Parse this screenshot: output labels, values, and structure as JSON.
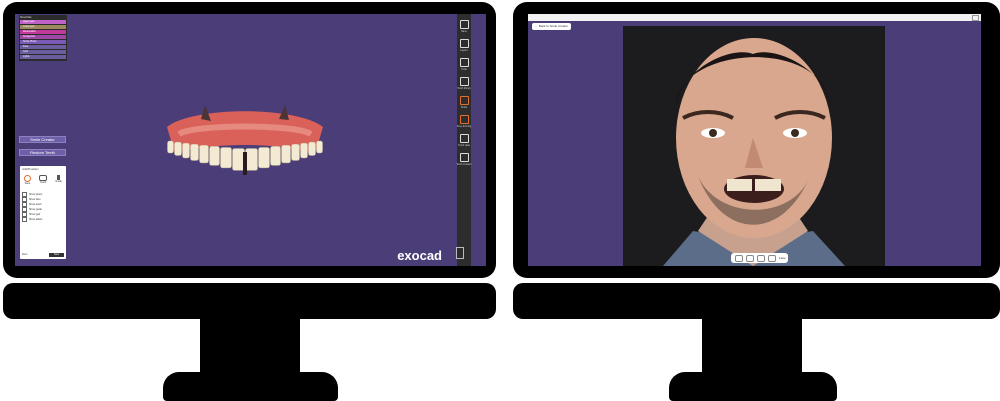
{
  "colors": {
    "screen_bg": "#4a3d78",
    "toolbar_bg": "#2d2d2d",
    "accent": "#7b5fc0",
    "gum": "#e07062",
    "tooth": "#f2ead2",
    "face_bg": "#1c1b1d"
  },
  "left_app": {
    "brand": "exocad",
    "object_panel": {
      "title": "Show/hide",
      "items": [
        {
          "label": "Upper jaw",
          "color": "#c061c8"
        },
        {
          "label": "Lower jaw",
          "color": "#9c8a5e"
        },
        {
          "label": "Restoration",
          "color": "#c0399a"
        },
        {
          "label": "Antagonist",
          "color": "#9d47a8"
        },
        {
          "label": "Smile Photo",
          "color": "#7a5ab5"
        },
        {
          "label": "Face",
          "color": "#6b5d9e"
        },
        {
          "label": "Grid",
          "color": "#6b5d9e"
        },
        {
          "label": "Lights",
          "color": "#6b5d9e"
        }
      ]
    },
    "toolbar": {
      "items": [
        {
          "icon": "save-icon",
          "label": "Save"
        },
        {
          "icon": "layers-icon",
          "label": "Layers"
        },
        {
          "icon": "tools-icon",
          "label": "Tools"
        },
        {
          "icon": "library-icon",
          "label": "Tooth library"
        },
        {
          "icon": "smile-icon",
          "label": "Smile"
        },
        {
          "icon": "hand-icon",
          "label": "Free-forming"
        },
        {
          "icon": "clipboard-icon",
          "label": "Tooth data"
        },
        {
          "icon": "tooth-icon",
          "label": "Tooth Creator"
        }
      ]
    },
    "steps": [
      "Smile Creator",
      "Restore Teeth"
    ],
    "wizard": {
      "title": "Add/Position",
      "tabs": [
        "Face",
        "Teeth",
        "Guide"
      ],
      "options": [
        "Show photo",
        "Show face",
        "Show teeth",
        "Show guide",
        "Show grid",
        "Show labels"
      ],
      "prev_label": "Back",
      "next_label": "Next"
    }
  },
  "right_app": {
    "back_button": "Back to Smile Creator",
    "controls": [
      "front-view-icon",
      "left-view-icon",
      "right-view-icon",
      "tilt-view-icon"
    ],
    "mode_label": "Face"
  }
}
